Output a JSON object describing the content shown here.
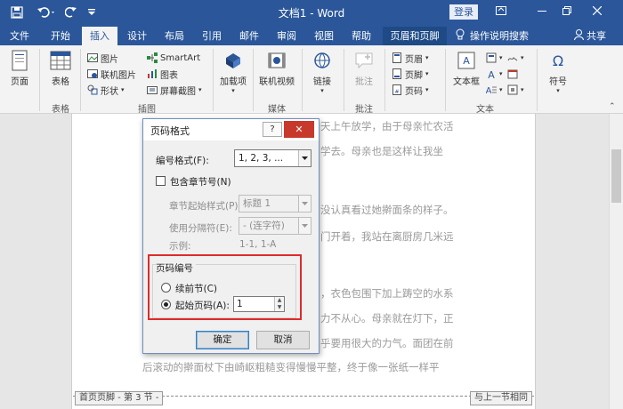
{
  "titlebar": {
    "title": "文档1 - Word",
    "login": "登录",
    "qa_save_icon": "save-icon",
    "qa_undo_icon": "undo-icon",
    "qa_redo_icon": "redo-icon"
  },
  "tabs": [
    "文件",
    "开始",
    "插入",
    "设计",
    "布局",
    "引用",
    "邮件",
    "审阅",
    "视图",
    "帮助",
    "页眉和页脚"
  ],
  "tellme": "操作说明搜索",
  "share": "共享",
  "ribbon": {
    "page": "页面",
    "table": "表格",
    "picture": "图片",
    "online_picture": "联机图片",
    "shapes": "形状",
    "smartart": "SmartArt",
    "chart": "图表",
    "screenshot": "屏幕截图",
    "addins": "加载项",
    "online_video": "联机视频",
    "link": "链接",
    "comment": "批注",
    "header": "页眉",
    "footer": "页脚",
    "page_number": "页码",
    "textbox": "文本框",
    "symbol": "符号",
    "groups": {
      "table": "表格",
      "illustrations": "插图",
      "media": "媒体",
      "comments": "批注",
      "text": "文本"
    }
  },
  "doc": {
    "lines": [
      "天上午放学，由于母亲忙农活",
      "学去。母亲也是这样让我坐",
      "没认真看过她擀面条的样子。",
      "门开着，我站在离厨房几米远",
      "，衣色包围下加上踌空的水系",
      "力不从心。母亲就在灯下，正",
      "乎要用很大的力气。面团在前",
      "后滚动的擀面杖下由崎岖粗糙变得慢慢平整，终于像一张纸一样平"
    ],
    "footer_left": "首页页脚 - 第 3 节 -",
    "footer_right": "与上一节相同"
  },
  "dialog": {
    "title": "页码格式",
    "number_format_label": "编号格式(F):",
    "number_format_value": "1, 2, 3, ...",
    "include_chapter": "包含章节号(N)",
    "chapter_style_label": "章节起始样式(P)",
    "chapter_style_value": "标题 1",
    "separator_label": "使用分隔符(E):",
    "separator_value": "-  (连字符)",
    "example_label": "示例:",
    "example_value": "1-1, 1-A",
    "numbering_group": "页码编号",
    "continue_prev": "续前节(C)",
    "start_at": "起始页码(A):",
    "start_at_value": "1",
    "ok": "确定",
    "cancel": "取消"
  }
}
